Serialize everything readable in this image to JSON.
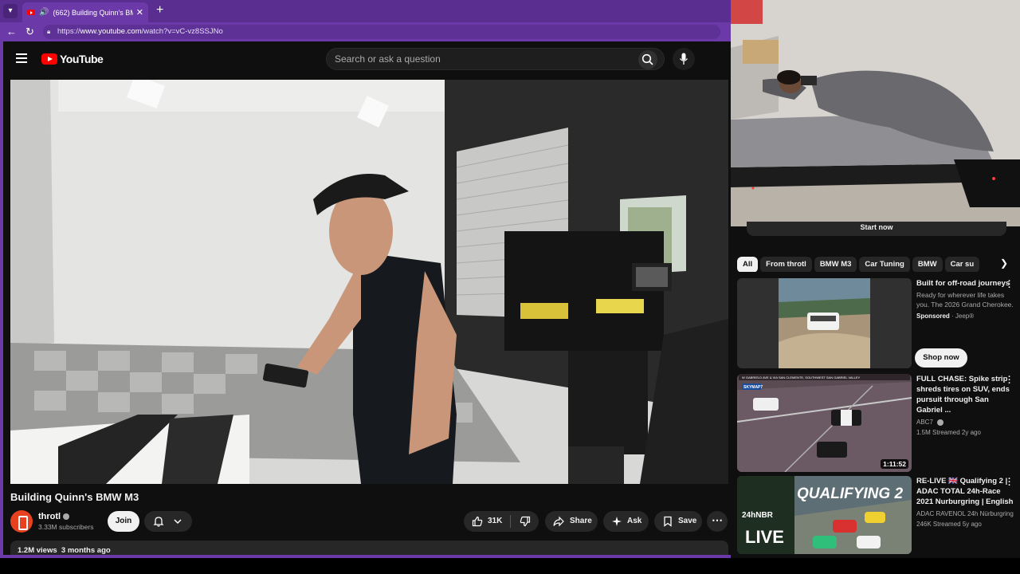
{
  "browser": {
    "tab_title": "(662) Building Quinn's BMW M",
    "tab_close": "✕",
    "new_tab": "+",
    "url_prefix": "https://",
    "url_host": "www.youtube.com",
    "url_path": "/watch?v=vC-vz8SSJNo"
  },
  "header": {
    "logo_text": "YouTube",
    "search_placeholder": "Search or ask a question"
  },
  "video": {
    "title": "Building Quinn's BMW M3",
    "channel": "throtl",
    "subscribers": "3.33M subscribers",
    "join_label": "Join",
    "likes": "31K",
    "share_label": "Share",
    "ask_label": "Ask",
    "save_label": "Save",
    "more_label": "⋯",
    "views": "1.2M views",
    "age": "3 months ago"
  },
  "sidebar": {
    "start_now": "Start now",
    "chips": [
      "All",
      "From throtl",
      "BMW M3",
      "Car Tuning",
      "BMW",
      "Car su"
    ],
    "items": [
      {
        "title": "Built for off-road journeys",
        "description": "Ready for wherever life takes you. The 2026 Grand Cherokee.",
        "sponsored": "Sponsored",
        "advertiser": "Jeep®",
        "cta": "Shop now"
      },
      {
        "title": "FULL CHASE: Spike strip shreds tires on SUV, ends pursuit through San Gabriel ...",
        "channel": "ABC7",
        "stats": "1.5M  Streamed 2y ago",
        "duration": "1:11:52",
        "overlay_caption": "W GABRIELD AVE & VIA SAN CLEMENTE, SOUTHWEST SAN GABRIEL VALLEY",
        "overlay_logo": "SKYMAP7"
      },
      {
        "title": "RE-LIVE 🇬🇧 Qualifying 2 | ADAC TOTAL 24h-Race 2021 Nurburgring | English",
        "channel": "ADAC RAVENOL 24h Nürburgring",
        "stats": "246K  Streamed 5y ago",
        "overlay_main": "QUALIFYING 2",
        "overlay_24h": "24hNBR",
        "overlay_live": "LIVE"
      }
    ]
  },
  "colors": {
    "browser_accent": "#6c3aa8",
    "youtube_red": "#ff0000",
    "page_bg": "#0f0f0f"
  },
  "icons": [
    "menu-icon",
    "search-icon",
    "mic-icon",
    "bell-icon",
    "chevron-down-icon",
    "like-icon",
    "dislike-icon",
    "share-icon",
    "ask-icon",
    "save-icon",
    "more-icon",
    "chevron-right-icon",
    "speaker-icon",
    "back-icon",
    "reload-icon",
    "lock-icon"
  ]
}
